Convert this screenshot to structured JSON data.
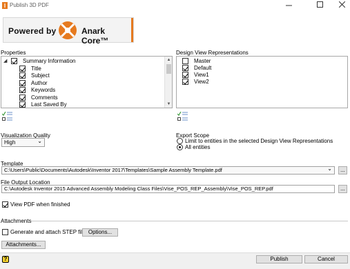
{
  "window": {
    "title": "Publish 3D PDF"
  },
  "logo": {
    "powered_by": "Powered by",
    "brand": "Anark Core™"
  },
  "properties": {
    "label": "Properties",
    "items": [
      {
        "label": "Summary Information",
        "checked": true,
        "expander": "◢"
      },
      {
        "label": "Title",
        "checked": true
      },
      {
        "label": "Subject",
        "checked": true
      },
      {
        "label": "Author",
        "checked": true
      },
      {
        "label": "Keywords",
        "checked": true
      },
      {
        "label": "Comments",
        "checked": true
      },
      {
        "label": "Last Saved By",
        "checked": true
      }
    ]
  },
  "design_views": {
    "label": "Design View Representations",
    "items": [
      {
        "label": "Master",
        "checked": false
      },
      {
        "label": "Default",
        "checked": true
      },
      {
        "label": "View1",
        "checked": true
      },
      {
        "label": "View2",
        "checked": true
      }
    ]
  },
  "visualization": {
    "label": "Visualization Quality",
    "value": "High",
    "arrow": "⌄"
  },
  "export_scope": {
    "label": "Export Scope",
    "options": [
      {
        "label": "Limit to entities in the selected Design View Representations",
        "selected": false
      },
      {
        "label": "All entities",
        "selected": true
      }
    ]
  },
  "template": {
    "label": "Template",
    "value": "C:\\Users\\Public\\Documents\\Autodesk\\Inventor 2017\\Templates\\Sample Assembly Template.pdf",
    "arrow": "⌄",
    "browse": "..."
  },
  "output": {
    "label": "File Output Location",
    "value": "C:\\Autodesk Inventor 2015 Advanced Assembly Modeling Class Files\\Vise_POS_REP_Assembly\\Vise_POS_REP.pdf",
    "browse": "..."
  },
  "view_pdf": {
    "label": "View PDF when finished",
    "checked": true
  },
  "attachments": {
    "label": "Attachments",
    "step_label": "Generate and attach STEP file",
    "step_checked": false,
    "options_button": "Options...",
    "attachments_button": "Attachments..."
  },
  "footer": {
    "help": "?",
    "publish": "Publish",
    "cancel": "Cancel"
  },
  "colors": {
    "logo_orange": "#e67a1f",
    "check_green": "#3c9a3c",
    "selection_blue": "#0078d7"
  }
}
